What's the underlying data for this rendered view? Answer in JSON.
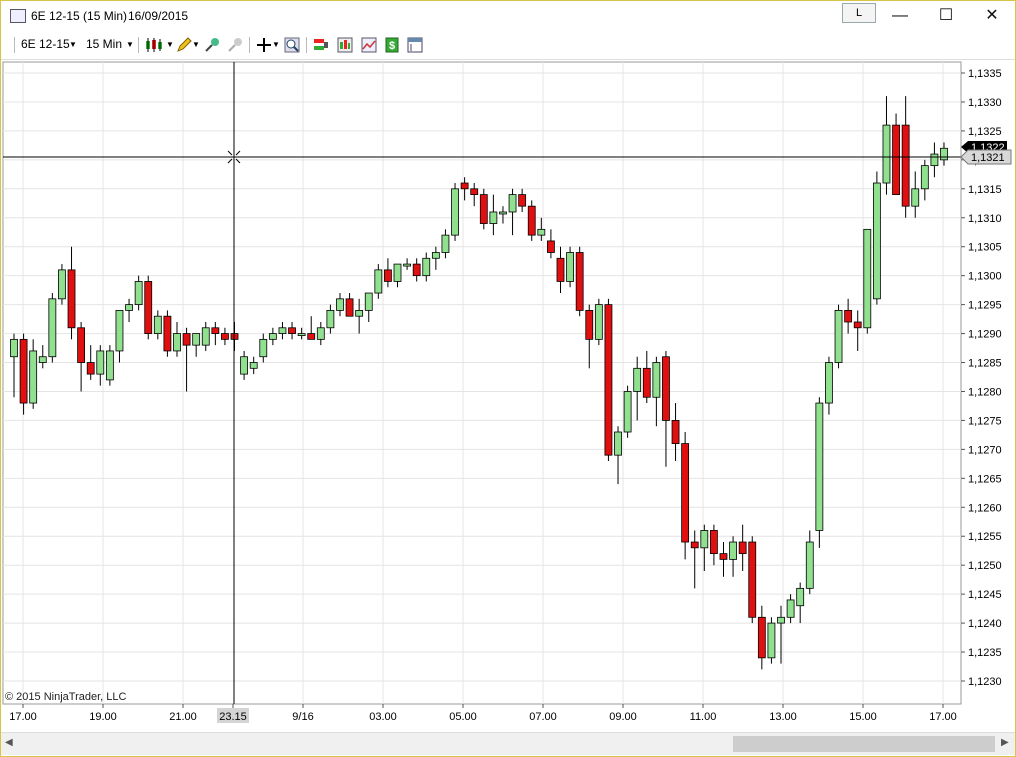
{
  "window": {
    "title": "6E 12-15 (15 Min)",
    "date": "16/09/2015",
    "l_button": "L",
    "minimize": "—",
    "maximize": "☐",
    "close": "✕"
  },
  "toolbar": {
    "instrument": "6E 12-15",
    "interval": "15 Min"
  },
  "copyright": "© 2015 NinjaTrader, LLC",
  "colors": {
    "up": "#90e090",
    "down": "#e01010",
    "wick": "#000000",
    "grid": "#e4e4e4"
  },
  "price_axis": {
    "labels": [
      "1,1335",
      "1,1330",
      "1,1325",
      "1,1320",
      "1,1315",
      "1,1310",
      "1,1305",
      "1,1300",
      "1,1295",
      "1,1290",
      "1,1285",
      "1,1280",
      "1,1275",
      "1,1270",
      "1,1265",
      "1,1260",
      "1,1255",
      "1,1250",
      "1,1245",
      "1,1240",
      "1,1235",
      "1,1230"
    ],
    "last_price": "1,1322",
    "crosshair_price": "1,1321"
  },
  "time_axis": {
    "labels": [
      "17.00",
      "19.00",
      "21.00",
      "23.15",
      "9/16",
      "03.00",
      "05.00",
      "07.00",
      "09.00",
      "11.00",
      "13.00",
      "15.00",
      "17.00"
    ],
    "highlight_index": 3
  },
  "chart_data": {
    "type": "candlestick",
    "ylim": [
      1.1228,
      1.1338
    ],
    "candles": [
      [
        1.1286,
        1.129,
        1.1279,
        1.1289
      ],
      [
        1.1289,
        1.129,
        1.1276,
        1.1278
      ],
      [
        1.1278,
        1.1289,
        1.1277,
        1.1287
      ],
      [
        1.1285,
        1.1288,
        1.1284,
        1.1286
      ],
      [
        1.1286,
        1.1297,
        1.1285,
        1.1296
      ],
      [
        1.1296,
        1.1302,
        1.1295,
        1.1301
      ],
      [
        1.1301,
        1.1305,
        1.1289,
        1.1291
      ],
      [
        1.1291,
        1.1292,
        1.128,
        1.1285
      ],
      [
        1.1285,
        1.1288,
        1.1282,
        1.1283
      ],
      [
        1.1283,
        1.1288,
        1.1281,
        1.1287
      ],
      [
        1.1282,
        1.1288,
        1.1281,
        1.1287
      ],
      [
        1.1287,
        1.1291,
        1.1285,
        1.1294
      ],
      [
        1.1294,
        1.1296,
        1.1292,
        1.1295
      ],
      [
        1.1295,
        1.13,
        1.1294,
        1.1299
      ],
      [
        1.1299,
        1.13,
        1.1289,
        1.129
      ],
      [
        1.129,
        1.1294,
        1.1289,
        1.1293
      ],
      [
        1.1293,
        1.1294,
        1.1286,
        1.1287
      ],
      [
        1.1287,
        1.1292,
        1.1286,
        1.129
      ],
      [
        1.129,
        1.1291,
        1.128,
        1.1288
      ],
      [
        1.1288,
        1.129,
        1.1286,
        1.129
      ],
      [
        1.1288,
        1.1292,
        1.1287,
        1.1291
      ],
      [
        1.1291,
        1.1292,
        1.1288,
        1.129
      ],
      [
        1.129,
        1.1291,
        1.1288,
        1.1289
      ],
      [
        1.129,
        1.1292,
        1.1287,
        1.1289
      ],
      [
        1.1283,
        1.1287,
        1.1282,
        1.1286
      ],
      [
        1.1284,
        1.1286,
        1.1283,
        1.1285
      ],
      [
        1.1286,
        1.129,
        1.1285,
        1.1289
      ],
      [
        1.1289,
        1.1291,
        1.1288,
        1.129
      ],
      [
        1.129,
        1.1292,
        1.1289,
        1.1291
      ],
      [
        1.1291,
        1.1292,
        1.1289,
        1.129
      ],
      [
        1.129,
        1.1291,
        1.1289,
        1.129
      ],
      [
        1.129,
        1.1293,
        1.1289,
        1.1289
      ],
      [
        1.1289,
        1.1292,
        1.1288,
        1.1291
      ],
      [
        1.1291,
        1.1295,
        1.129,
        1.1294
      ],
      [
        1.1294,
        1.1297,
        1.1293,
        1.1296
      ],
      [
        1.1296,
        1.1297,
        1.1294,
        1.1293
      ],
      [
        1.1293,
        1.1296,
        1.129,
        1.1294
      ],
      [
        1.1294,
        1.1296,
        1.1292,
        1.1297
      ],
      [
        1.1297,
        1.1302,
        1.1296,
        1.1301
      ],
      [
        1.1301,
        1.1303,
        1.1298,
        1.1299
      ],
      [
        1.1299,
        1.1302,
        1.1298,
        1.1302
      ],
      [
        1.1302,
        1.1303,
        1.1301,
        1.1302
      ],
      [
        1.1302,
        1.1303,
        1.1299,
        1.13
      ],
      [
        1.13,
        1.1304,
        1.1299,
        1.1303
      ],
      [
        1.1303,
        1.1305,
        1.1301,
        1.1304
      ],
      [
        1.1304,
        1.1308,
        1.1303,
        1.1307
      ],
      [
        1.1307,
        1.1316,
        1.1306,
        1.1315
      ],
      [
        1.1316,
        1.1317,
        1.1313,
        1.1315
      ],
      [
        1.1315,
        1.1316,
        1.1312,
        1.1314
      ],
      [
        1.1314,
        1.1315,
        1.1308,
        1.1309
      ],
      [
        1.1309,
        1.1314,
        1.1307,
        1.1311
      ],
      [
        1.1311,
        1.1312,
        1.1309,
        1.1311
      ],
      [
        1.1311,
        1.1315,
        1.1307,
        1.1314
      ],
      [
        1.1314,
        1.1315,
        1.1311,
        1.1312
      ],
      [
        1.1312,
        1.1313,
        1.1306,
        1.1307
      ],
      [
        1.1307,
        1.131,
        1.1306,
        1.1308
      ],
      [
        1.1306,
        1.1308,
        1.1303,
        1.1304
      ],
      [
        1.1303,
        1.1305,
        1.1297,
        1.1299
      ],
      [
        1.1299,
        1.1305,
        1.1298,
        1.1304
      ],
      [
        1.1304,
        1.1305,
        1.1293,
        1.1294
      ],
      [
        1.1294,
        1.1295,
        1.1284,
        1.1289
      ],
      [
        1.1289,
        1.1296,
        1.1288,
        1.1295
      ],
      [
        1.1295,
        1.1296,
        1.1268,
        1.1269
      ],
      [
        1.1269,
        1.1274,
        1.1264,
        1.1273
      ],
      [
        1.1273,
        1.1281,
        1.1272,
        1.128
      ],
      [
        1.128,
        1.1286,
        1.1275,
        1.1284
      ],
      [
        1.1284,
        1.1287,
        1.1278,
        1.1279
      ],
      [
        1.1279,
        1.1286,
        1.1274,
        1.1285
      ],
      [
        1.1286,
        1.1287,
        1.1267,
        1.1275
      ],
      [
        1.1275,
        1.1278,
        1.1268,
        1.1271
      ],
      [
        1.1271,
        1.1273,
        1.1251,
        1.1254
      ],
      [
        1.1254,
        1.1256,
        1.1246,
        1.1253
      ],
      [
        1.1253,
        1.1257,
        1.1249,
        1.1256
      ],
      [
        1.1256,
        1.1257,
        1.125,
        1.1252
      ],
      [
        1.1252,
        1.1254,
        1.1248,
        1.1251
      ],
      [
        1.1251,
        1.1255,
        1.1248,
        1.1254
      ],
      [
        1.1254,
        1.1257,
        1.1249,
        1.1252
      ],
      [
        1.1254,
        1.1255,
        1.124,
        1.1241
      ],
      [
        1.1241,
        1.1243,
        1.1232,
        1.1234
      ],
      [
        1.1234,
        1.1241,
        1.1233,
        1.124
      ],
      [
        1.124,
        1.1243,
        1.1233,
        1.1241
      ],
      [
        1.1241,
        1.1245,
        1.124,
        1.1244
      ],
      [
        1.1243,
        1.1247,
        1.124,
        1.1246
      ],
      [
        1.1246,
        1.1256,
        1.1245,
        1.1254
      ],
      [
        1.1256,
        1.1279,
        1.1253,
        1.1278
      ],
      [
        1.1278,
        1.1286,
        1.1276,
        1.1285
      ],
      [
        1.1285,
        1.1295,
        1.1284,
        1.1294
      ],
      [
        1.1294,
        1.1296,
        1.129,
        1.1292
      ],
      [
        1.1292,
        1.1294,
        1.1287,
        1.1291
      ],
      [
        1.1291,
        1.1298,
        1.129,
        1.1308
      ],
      [
        1.1296,
        1.1318,
        1.1295,
        1.1316
      ],
      [
        1.1316,
        1.1331,
        1.1314,
        1.1326
      ],
      [
        1.1326,
        1.1328,
        1.1314,
        1.1314
      ],
      [
        1.1326,
        1.1331,
        1.131,
        1.1312
      ],
      [
        1.1312,
        1.1318,
        1.131,
        1.1315
      ],
      [
        1.1315,
        1.132,
        1.1313,
        1.1319
      ],
      [
        1.1319,
        1.1323,
        1.1317,
        1.1321
      ],
      [
        1.132,
        1.1323,
        1.1319,
        1.1322
      ]
    ]
  }
}
